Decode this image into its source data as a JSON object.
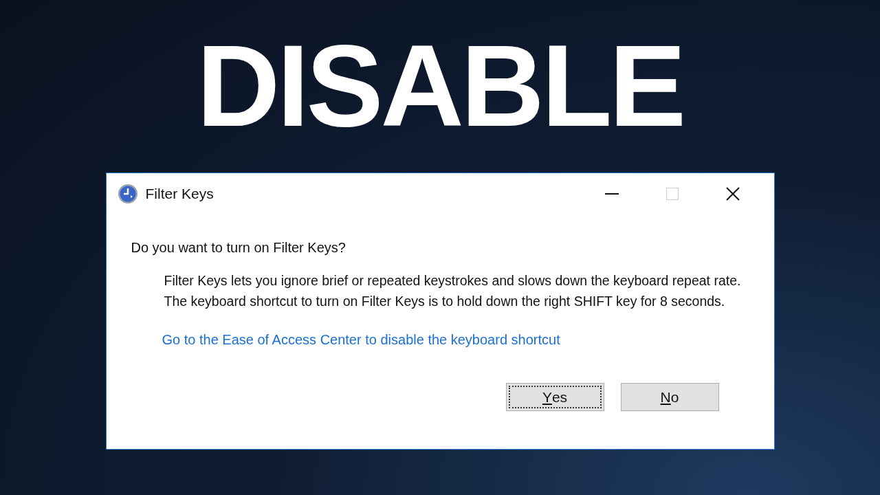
{
  "headline": "DISABLE",
  "window": {
    "title": "Filter Keys",
    "controls": [
      {
        "kind": "minimize",
        "disabled": false
      },
      {
        "kind": "maximize",
        "disabled": true
      },
      {
        "kind": "close",
        "disabled": false
      }
    ]
  },
  "question": "Do you want to turn on Filter Keys?",
  "description": "Filter Keys lets you ignore brief or repeated keystrokes and slows down the keyboard repeat rate.  The keyboard shortcut to turn on Filter Keys is to hold down the right SHIFT key for 8 seconds.",
  "link": "Go to the Ease of Access Center to disable the keyboard shortcut",
  "buttons": [
    {
      "access_key": "Y",
      "label_rest": "es",
      "focused": true
    },
    {
      "access_key": "N",
      "label_rest": "o",
      "focused": false
    }
  ]
}
